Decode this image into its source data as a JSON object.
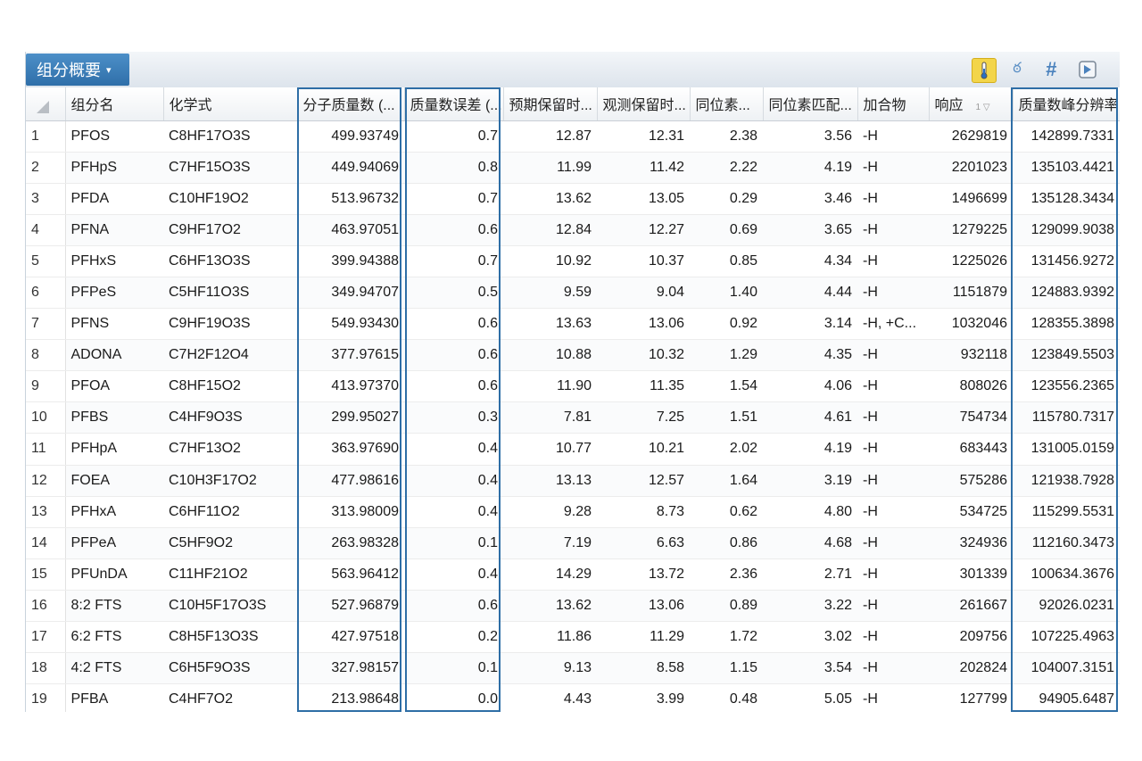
{
  "toolbar": {
    "menu_label": "组分概要",
    "menu_caret": "▾",
    "icons": [
      "thermometer-icon",
      "dna-icon",
      "hash-icon",
      "image-icon"
    ]
  },
  "table": {
    "columns": [
      "组分名",
      "化学式",
      "分子质量数 (...",
      "质量数误差 (...",
      "预期保留时...",
      "观测保留时...",
      "同位素...",
      "同位素匹配...",
      "加合物",
      "响应",
      "质量数峰分辨率"
    ],
    "sort_indicator": "1 ▽",
    "rows": [
      [
        "1",
        "PFOS",
        "C8HF17O3S",
        "499.93749",
        "0.7",
        "12.87",
        "12.31",
        "2.38",
        "3.56",
        "-H",
        "2629819",
        "142899.7331"
      ],
      [
        "2",
        "PFHpS",
        "C7HF15O3S",
        "449.94069",
        "0.8",
        "11.99",
        "11.42",
        "2.22",
        "4.19",
        "-H",
        "2201023",
        "135103.4421"
      ],
      [
        "3",
        "PFDA",
        "C10HF19O2",
        "513.96732",
        "0.7",
        "13.62",
        "13.05",
        "0.29",
        "3.46",
        "-H",
        "1496699",
        "135128.3434"
      ],
      [
        "4",
        "PFNA",
        "C9HF17O2",
        "463.97051",
        "0.6",
        "12.84",
        "12.27",
        "0.69",
        "3.65",
        "-H",
        "1279225",
        "129099.9038"
      ],
      [
        "5",
        "PFHxS",
        "C6HF13O3S",
        "399.94388",
        "0.7",
        "10.92",
        "10.37",
        "0.85",
        "4.34",
        "-H",
        "1225026",
        "131456.9272"
      ],
      [
        "6",
        "PFPeS",
        "C5HF11O3S",
        "349.94707",
        "0.5",
        "9.59",
        "9.04",
        "1.40",
        "4.44",
        "-H",
        "1151879",
        "124883.9392"
      ],
      [
        "7",
        "PFNS",
        "C9HF19O3S",
        "549.93430",
        "0.6",
        "13.63",
        "13.06",
        "0.92",
        "3.14",
        "-H, +C...",
        "1032046",
        "128355.3898"
      ],
      [
        "8",
        "ADONA",
        "C7H2F12O4",
        "377.97615",
        "0.6",
        "10.88",
        "10.32",
        "1.29",
        "4.35",
        "-H",
        "932118",
        "123849.5503"
      ],
      [
        "9",
        "PFOA",
        "C8HF15O2",
        "413.97370",
        "0.6",
        "11.90",
        "11.35",
        "1.54",
        "4.06",
        "-H",
        "808026",
        "123556.2365"
      ],
      [
        "10",
        "PFBS",
        "C4HF9O3S",
        "299.95027",
        "0.3",
        "7.81",
        "7.25",
        "1.51",
        "4.61",
        "-H",
        "754734",
        "115780.7317"
      ],
      [
        "11",
        "PFHpA",
        "C7HF13O2",
        "363.97690",
        "0.4",
        "10.77",
        "10.21",
        "2.02",
        "4.19",
        "-H",
        "683443",
        "131005.0159"
      ],
      [
        "12",
        "FOEA",
        "C10H3F17O2",
        "477.98616",
        "0.4",
        "13.13",
        "12.57",
        "1.64",
        "3.19",
        "-H",
        "575286",
        "121938.7928"
      ],
      [
        "13",
        "PFHxA",
        "C6HF11O2",
        "313.98009",
        "0.4",
        "9.28",
        "8.73",
        "0.62",
        "4.80",
        "-H",
        "534725",
        "115299.5531"
      ],
      [
        "14",
        "PFPeA",
        "C5HF9O2",
        "263.98328",
        "0.1",
        "7.19",
        "6.63",
        "0.86",
        "4.68",
        "-H",
        "324936",
        "112160.3473"
      ],
      [
        "15",
        "PFUnDA",
        "C11HF21O2",
        "563.96412",
        "0.4",
        "14.29",
        "13.72",
        "2.36",
        "2.71",
        "-H",
        "301339",
        "100634.3676"
      ],
      [
        "16",
        "8:2 FTS",
        "C10H5F17O3S",
        "527.96879",
        "0.6",
        "13.62",
        "13.06",
        "0.89",
        "3.22",
        "-H",
        "261667",
        "92026.0231"
      ],
      [
        "17",
        "6:2 FTS",
        "C8H5F13O3S",
        "427.97518",
        "0.2",
        "11.86",
        "11.29",
        "1.72",
        "3.02",
        "-H",
        "209756",
        "107225.4963"
      ],
      [
        "18",
        "4:2 FTS",
        "C6H5F9O3S",
        "327.98157",
        "0.1",
        "9.13",
        "8.58",
        "1.15",
        "3.54",
        "-H",
        "202824",
        "104007.3151"
      ],
      [
        "19",
        "PFBA",
        "C4HF7O2",
        "213.98648",
        "0.0",
        "4.43",
        "3.99",
        "0.48",
        "5.05",
        "-H",
        "127799",
        "94905.6487"
      ]
    ]
  },
  "colors": {
    "toolbar_button": "#3a7cb8",
    "highlight_frame": "#2e6ea6",
    "thermometer_bg": "#f3d54a"
  }
}
